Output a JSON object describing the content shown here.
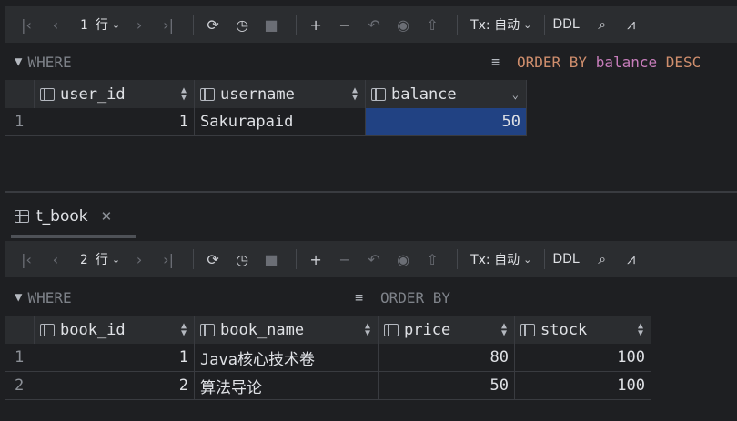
{
  "top": {
    "toolbar": {
      "rows_label": "1 行",
      "tx_label": "Tx: 自动",
      "ddl_label": "DDL"
    },
    "filter": {
      "where_label": "WHERE",
      "order_prefix": "ORDER BY",
      "order_col": "balance",
      "order_dir": "DESC"
    },
    "columns": [
      "user_id",
      "username",
      "balance"
    ],
    "rows": [
      {
        "num": "1",
        "user_id": "1",
        "username": "Sakurapaid",
        "balance": "50"
      }
    ]
  },
  "tab": {
    "label": "t_book"
  },
  "bottom": {
    "toolbar": {
      "rows_label": "2 行",
      "tx_label": "Tx: 自动",
      "ddl_label": "DDL"
    },
    "filter": {
      "where_label": "WHERE",
      "order_label": "ORDER BY"
    },
    "columns": [
      "book_id",
      "book_name",
      "price",
      "stock"
    ],
    "rows": [
      {
        "num": "1",
        "book_id": "1",
        "book_name": "Java核心技术卷",
        "price": "80",
        "stock": "100"
      },
      {
        "num": "2",
        "book_id": "2",
        "book_name": "算法导论",
        "price": "50",
        "stock": "100"
      }
    ]
  },
  "colors": {
    "accent_selected": "#214283",
    "keyword": "#cf8e6d",
    "identifier": "#c77dbb"
  }
}
